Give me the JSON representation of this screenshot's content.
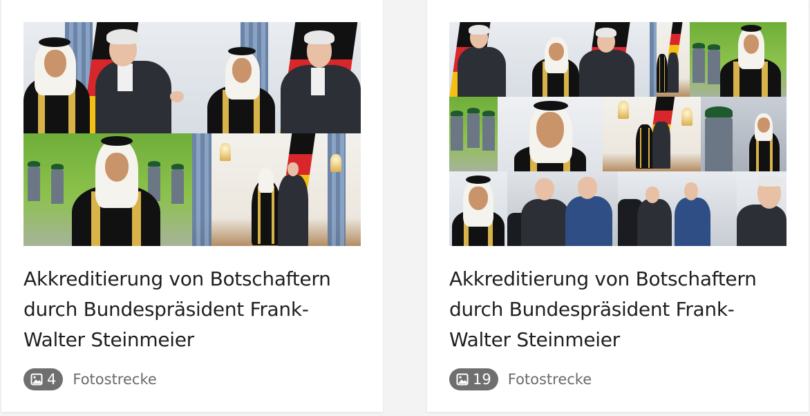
{
  "cards": [
    {
      "title": "Akkreditierung von Botschaftern durch Bundespräsident Frank-Walter Steinmeier",
      "count": "4",
      "type_label": "Fotostrecke",
      "icon": "image-icon"
    },
    {
      "title": "Akkreditierung von Botschaftern durch Bundespräsident Frank-Walter Steinmeier",
      "count": "19",
      "type_label": "Fotostrecke",
      "icon": "image-icon"
    }
  ],
  "colors": {
    "badge_bg": "#6f6f6f",
    "title_text": "#1f1f1f",
    "meta_text": "#6a6a6a",
    "card_bg": "#ffffff",
    "page_bg": "#f3f3f3"
  }
}
